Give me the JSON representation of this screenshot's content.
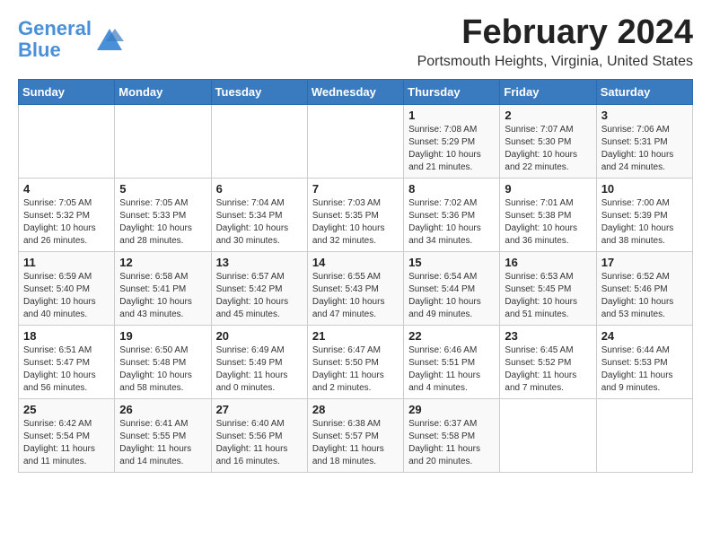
{
  "app": {
    "name": "GeneralBlue",
    "logo_text_part1": "General",
    "logo_text_part2": "Blue"
  },
  "header": {
    "month_year": "February 2024",
    "location": "Portsmouth Heights, Virginia, United States"
  },
  "days_of_week": [
    "Sunday",
    "Monday",
    "Tuesday",
    "Wednesday",
    "Thursday",
    "Friday",
    "Saturday"
  ],
  "weeks": [
    {
      "days": [
        {
          "num": "",
          "info": ""
        },
        {
          "num": "",
          "info": ""
        },
        {
          "num": "",
          "info": ""
        },
        {
          "num": "",
          "info": ""
        },
        {
          "num": "1",
          "info": "Sunrise: 7:08 AM\nSunset: 5:29 PM\nDaylight: 10 hours\nand 21 minutes."
        },
        {
          "num": "2",
          "info": "Sunrise: 7:07 AM\nSunset: 5:30 PM\nDaylight: 10 hours\nand 22 minutes."
        },
        {
          "num": "3",
          "info": "Sunrise: 7:06 AM\nSunset: 5:31 PM\nDaylight: 10 hours\nand 24 minutes."
        }
      ]
    },
    {
      "days": [
        {
          "num": "4",
          "info": "Sunrise: 7:05 AM\nSunset: 5:32 PM\nDaylight: 10 hours\nand 26 minutes."
        },
        {
          "num": "5",
          "info": "Sunrise: 7:05 AM\nSunset: 5:33 PM\nDaylight: 10 hours\nand 28 minutes."
        },
        {
          "num": "6",
          "info": "Sunrise: 7:04 AM\nSunset: 5:34 PM\nDaylight: 10 hours\nand 30 minutes."
        },
        {
          "num": "7",
          "info": "Sunrise: 7:03 AM\nSunset: 5:35 PM\nDaylight: 10 hours\nand 32 minutes."
        },
        {
          "num": "8",
          "info": "Sunrise: 7:02 AM\nSunset: 5:36 PM\nDaylight: 10 hours\nand 34 minutes."
        },
        {
          "num": "9",
          "info": "Sunrise: 7:01 AM\nSunset: 5:38 PM\nDaylight: 10 hours\nand 36 minutes."
        },
        {
          "num": "10",
          "info": "Sunrise: 7:00 AM\nSunset: 5:39 PM\nDaylight: 10 hours\nand 38 minutes."
        }
      ]
    },
    {
      "days": [
        {
          "num": "11",
          "info": "Sunrise: 6:59 AM\nSunset: 5:40 PM\nDaylight: 10 hours\nand 40 minutes."
        },
        {
          "num": "12",
          "info": "Sunrise: 6:58 AM\nSunset: 5:41 PM\nDaylight: 10 hours\nand 43 minutes."
        },
        {
          "num": "13",
          "info": "Sunrise: 6:57 AM\nSunset: 5:42 PM\nDaylight: 10 hours\nand 45 minutes."
        },
        {
          "num": "14",
          "info": "Sunrise: 6:55 AM\nSunset: 5:43 PM\nDaylight: 10 hours\nand 47 minutes."
        },
        {
          "num": "15",
          "info": "Sunrise: 6:54 AM\nSunset: 5:44 PM\nDaylight: 10 hours\nand 49 minutes."
        },
        {
          "num": "16",
          "info": "Sunrise: 6:53 AM\nSunset: 5:45 PM\nDaylight: 10 hours\nand 51 minutes."
        },
        {
          "num": "17",
          "info": "Sunrise: 6:52 AM\nSunset: 5:46 PM\nDaylight: 10 hours\nand 53 minutes."
        }
      ]
    },
    {
      "days": [
        {
          "num": "18",
          "info": "Sunrise: 6:51 AM\nSunset: 5:47 PM\nDaylight: 10 hours\nand 56 minutes."
        },
        {
          "num": "19",
          "info": "Sunrise: 6:50 AM\nSunset: 5:48 PM\nDaylight: 10 hours\nand 58 minutes."
        },
        {
          "num": "20",
          "info": "Sunrise: 6:49 AM\nSunset: 5:49 PM\nDaylight: 11 hours\nand 0 minutes."
        },
        {
          "num": "21",
          "info": "Sunrise: 6:47 AM\nSunset: 5:50 PM\nDaylight: 11 hours\nand 2 minutes."
        },
        {
          "num": "22",
          "info": "Sunrise: 6:46 AM\nSunset: 5:51 PM\nDaylight: 11 hours\nand 4 minutes."
        },
        {
          "num": "23",
          "info": "Sunrise: 6:45 AM\nSunset: 5:52 PM\nDaylight: 11 hours\nand 7 minutes."
        },
        {
          "num": "24",
          "info": "Sunrise: 6:44 AM\nSunset: 5:53 PM\nDaylight: 11 hours\nand 9 minutes."
        }
      ]
    },
    {
      "days": [
        {
          "num": "25",
          "info": "Sunrise: 6:42 AM\nSunset: 5:54 PM\nDaylight: 11 hours\nand 11 minutes."
        },
        {
          "num": "26",
          "info": "Sunrise: 6:41 AM\nSunset: 5:55 PM\nDaylight: 11 hours\nand 14 minutes."
        },
        {
          "num": "27",
          "info": "Sunrise: 6:40 AM\nSunset: 5:56 PM\nDaylight: 11 hours\nand 16 minutes."
        },
        {
          "num": "28",
          "info": "Sunrise: 6:38 AM\nSunset: 5:57 PM\nDaylight: 11 hours\nand 18 minutes."
        },
        {
          "num": "29",
          "info": "Sunrise: 6:37 AM\nSunset: 5:58 PM\nDaylight: 11 hours\nand 20 minutes."
        },
        {
          "num": "",
          "info": ""
        },
        {
          "num": "",
          "info": ""
        }
      ]
    }
  ]
}
